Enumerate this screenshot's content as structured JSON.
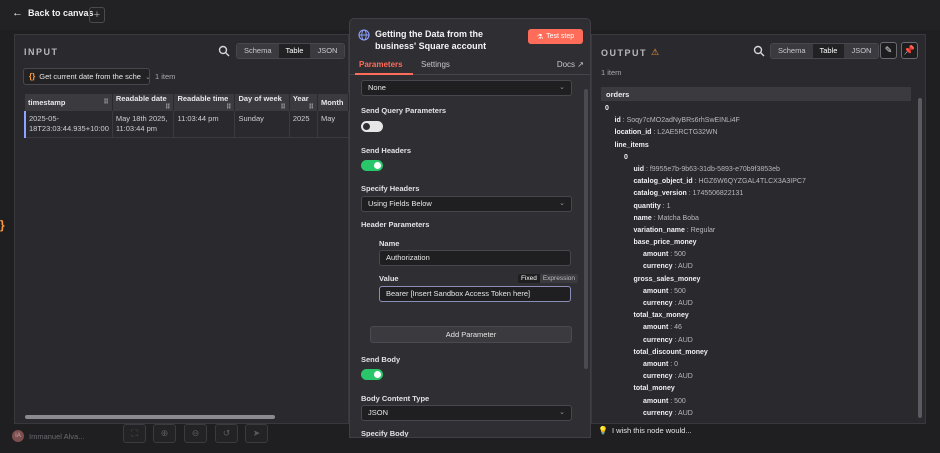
{
  "topbar": {
    "back_label": "Back to canvas",
    "plus_label": "+"
  },
  "input_panel": {
    "title": "INPUT",
    "views": [
      "Schema",
      "Table",
      "JSON"
    ],
    "active_view": "Table",
    "node_select": "Get current date from the sche",
    "item_count": "1 item",
    "columns": [
      "timestamp",
      "Readable date",
      "Readable time",
      "Day of week",
      "Year",
      "Month"
    ],
    "rows": [
      [
        "2025-05-18T23:03:44.935+10:00",
        "May 18th 2025, 11:03:44 pm",
        "11:03:44 pm",
        "Sunday",
        "2025",
        "May"
      ]
    ]
  },
  "node": {
    "title": "Getting the Data from the business' Square account",
    "test_button": "Test step",
    "tabs": [
      "Parameters",
      "Settings"
    ],
    "active_tab": "Parameters",
    "docs_label": "Docs",
    "auth_value": "None",
    "send_query_label": "Send Query Parameters",
    "send_query": false,
    "send_headers_label": "Send Headers",
    "send_headers": true,
    "specify_headers_label": "Specify Headers",
    "specify_headers_value": "Using Fields Below",
    "header_params_label": "Header Parameters",
    "name_label": "Name",
    "name_value": "Authorization",
    "value_label": "Value",
    "mode_fixed": "Fixed",
    "mode_expression": "Expression",
    "value_value": "Bearer [Insert Sandbox Access Token here]",
    "add_param_label": "Add Parameter",
    "send_body_label": "Send Body",
    "send_body": true,
    "body_content_type_label": "Body Content Type",
    "body_content_type_value": "JSON",
    "specify_body_label": "Specify Body"
  },
  "output_panel": {
    "title": "OUTPUT",
    "views": [
      "Schema",
      "Table",
      "JSON"
    ],
    "active_view": "Table",
    "item_count": "1 item",
    "root_key": "orders",
    "lines": [
      {
        "indent": 0,
        "key": "0",
        "value": ""
      },
      {
        "indent": 1,
        "key": "id",
        "value": "Soqy7cMO2adNyBRs6rhSwEINLi4F"
      },
      {
        "indent": 1,
        "key": "location_id",
        "value": "L2AE5RCTG32WN"
      },
      {
        "indent": 1,
        "key": "line_items",
        "value": ""
      },
      {
        "indent": 2,
        "key": "0",
        "value": ""
      },
      {
        "indent": 3,
        "key": "uid",
        "value": "f9955e7b-9b63-31db-5893-e70b9f3853eb"
      },
      {
        "indent": 3,
        "key": "catalog_object_id",
        "value": "HGZ6W6QYZGAL4TLCX3A3IPC7"
      },
      {
        "indent": 3,
        "key": "catalog_version",
        "value": "1745506822131"
      },
      {
        "indent": 3,
        "key": "quantity",
        "value": "1"
      },
      {
        "indent": 3,
        "key": "name",
        "value": "Matcha Boba"
      },
      {
        "indent": 3,
        "key": "variation_name",
        "value": "Regular"
      },
      {
        "indent": 3,
        "key": "base_price_money",
        "value": ""
      },
      {
        "indent": 4,
        "key": "amount",
        "value": "500"
      },
      {
        "indent": 4,
        "key": "currency",
        "value": "AUD"
      },
      {
        "indent": 3,
        "key": "gross_sales_money",
        "value": ""
      },
      {
        "indent": 4,
        "key": "amount",
        "value": "500"
      },
      {
        "indent": 4,
        "key": "currency",
        "value": "AUD"
      },
      {
        "indent": 3,
        "key": "total_tax_money",
        "value": ""
      },
      {
        "indent": 4,
        "key": "amount",
        "value": "46"
      },
      {
        "indent": 4,
        "key": "currency",
        "value": "AUD"
      },
      {
        "indent": 3,
        "key": "total_discount_money",
        "value": ""
      },
      {
        "indent": 4,
        "key": "amount",
        "value": "0"
      },
      {
        "indent": 4,
        "key": "currency",
        "value": "AUD"
      },
      {
        "indent": 3,
        "key": "total_money",
        "value": ""
      },
      {
        "indent": 4,
        "key": "amount",
        "value": "500"
      },
      {
        "indent": 4,
        "key": "currency",
        "value": "AUD"
      }
    ]
  },
  "bottom": {
    "user_name": "Immanuel Alva...",
    "feedback_label": "I wish this node would..."
  },
  "colors": {
    "accent": "#ff6d5a",
    "toggle_on": "#29c66a",
    "warning": "#ff9b3d"
  }
}
